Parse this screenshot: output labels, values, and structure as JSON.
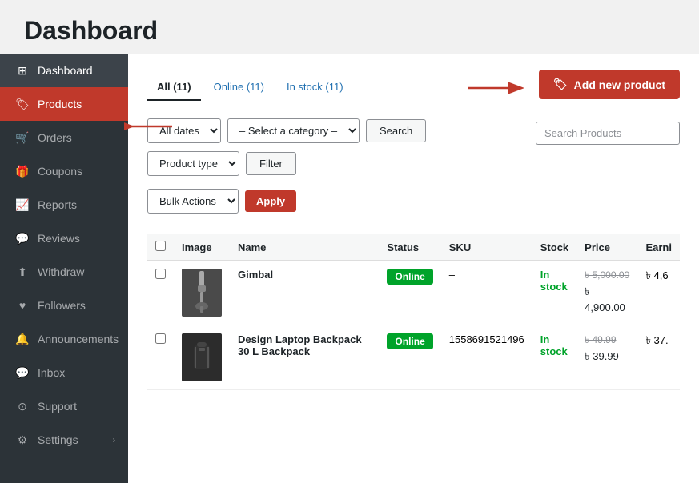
{
  "page": {
    "title": "Dashboard"
  },
  "sidebar": {
    "items": [
      {
        "id": "dashboard",
        "label": "Dashboard",
        "icon": "dashboard-icon",
        "active": false,
        "dashboard_active": true
      },
      {
        "id": "products",
        "label": "Products",
        "icon": "products-icon",
        "active": true
      },
      {
        "id": "orders",
        "label": "Orders",
        "icon": "orders-icon",
        "active": false
      },
      {
        "id": "coupons",
        "label": "Coupons",
        "icon": "coupons-icon",
        "active": false
      },
      {
        "id": "reports",
        "label": "Reports",
        "icon": "reports-icon",
        "active": false
      },
      {
        "id": "reviews",
        "label": "Reviews",
        "icon": "reviews-icon",
        "active": false
      },
      {
        "id": "withdraw",
        "label": "Withdraw",
        "icon": "withdraw-icon",
        "active": false
      },
      {
        "id": "followers",
        "label": "Followers",
        "icon": "followers-icon",
        "active": false
      },
      {
        "id": "announcements",
        "label": "Announcements",
        "icon": "announcements-icon",
        "active": false
      },
      {
        "id": "inbox",
        "label": "Inbox",
        "icon": "inbox-icon",
        "active": false
      },
      {
        "id": "support",
        "label": "Support",
        "icon": "support-icon",
        "active": false
      },
      {
        "id": "settings",
        "label": "Settings",
        "icon": "settings-icon",
        "active": false,
        "has_arrow": true
      }
    ]
  },
  "tabs": {
    "items": [
      {
        "id": "all",
        "label": "All (11)",
        "active": true
      },
      {
        "id": "online",
        "label": "Online (11)",
        "active": false
      },
      {
        "id": "in_stock",
        "label": "In stock (11)",
        "active": false
      }
    ]
  },
  "add_product_btn": "Add new product",
  "filters": {
    "date_options": [
      "All dates"
    ],
    "date_selected": "All dates",
    "category_placeholder": "– Select a category –",
    "search_btn": "Search",
    "product_type_label": "Product type",
    "filter_btn": "Filter",
    "bulk_actions_label": "Bulk Actions",
    "apply_btn": "Apply",
    "search_placeholder": "Search Products"
  },
  "table": {
    "headers": [
      "",
      "Image",
      "Name",
      "Status",
      "SKU",
      "Stock",
      "Price",
      "Earni"
    ],
    "rows": [
      {
        "id": "gimbal",
        "name": "Gimbal",
        "status": "Online",
        "sku": "–",
        "stock": "In stock",
        "price_original": "৳ 5,000.00",
        "price_sale": "৳ 4,900.00",
        "earnings": "৳ 4,6"
      },
      {
        "id": "backpack",
        "name": "Design Laptop Backpack 30 L Backpack",
        "status": "Online",
        "sku": "1558691521496",
        "stock": "In stock",
        "price_original": "৳ 49.99",
        "price_sale": "৳ 39.99",
        "earnings": "৳ 37."
      }
    ]
  }
}
